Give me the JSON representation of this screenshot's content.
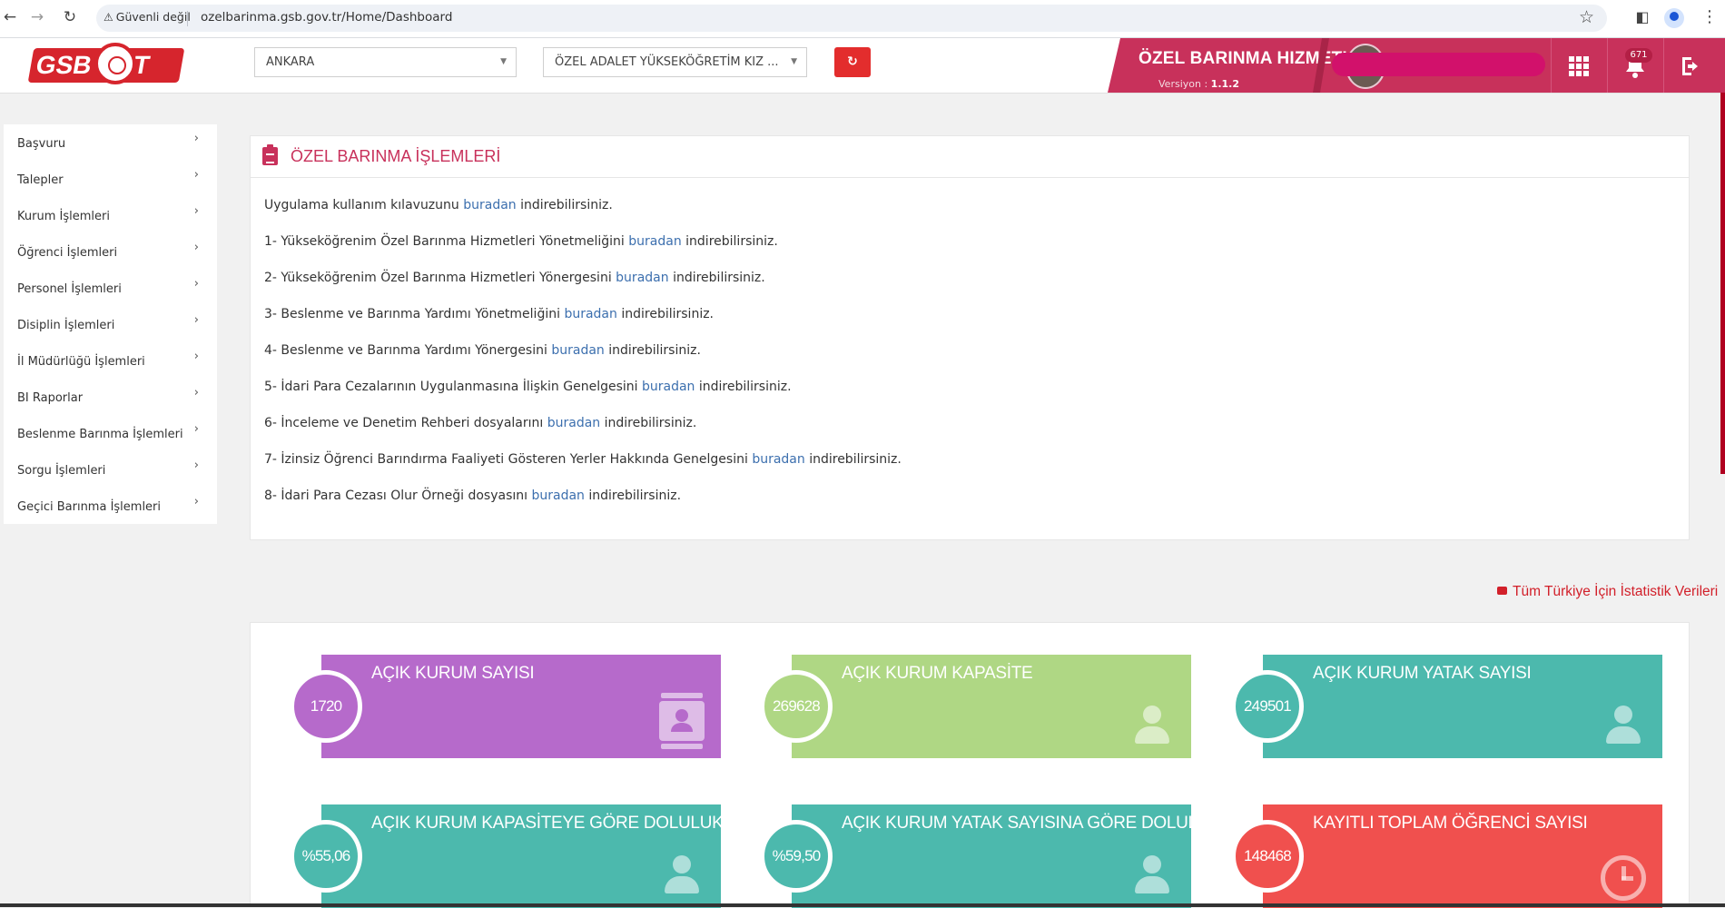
{
  "browser": {
    "security_label": "Güvenli değil",
    "url": "ozelbarinma.gsb.gov.tr/Home/Dashboard"
  },
  "header": {
    "logo_text": "GSB   NET",
    "province_select": "ANKARA",
    "institution_select": "ÖZEL ADALET YÜKSEKÖĞRETİM KIZ ...",
    "brand_title": "ÖZEL BARINMA HIZMETI",
    "version_label": "Versiyon :",
    "version_value": "1.1.2",
    "notification_count": "671",
    "colors": {
      "brand": "#c8315b",
      "logo_red": "#d6252d",
      "refresh_button": "#e32d2d"
    }
  },
  "sidebar": {
    "items": [
      {
        "label": "Başvuru"
      },
      {
        "label": "Talepler"
      },
      {
        "label": "Kurum İşlemleri"
      },
      {
        "label": "Öğrenci İşlemleri"
      },
      {
        "label": "Personel İşlemleri"
      },
      {
        "label": "Disiplin İşlemleri"
      },
      {
        "label": "İl Müdürlüğü İşlemleri"
      },
      {
        "label": "BI Raporlar"
      },
      {
        "label": "Beslenme Barınma İşlemleri"
      },
      {
        "label": "Sorgu İşlemleri"
      },
      {
        "label": "Geçici Barınma İşlemleri"
      }
    ]
  },
  "panel": {
    "title": "ÖZEL BARINMA İŞLEMLERİ",
    "link_text": "buradan",
    "lines": [
      {
        "before": "Uygulama kullanım kılavuzunu",
        "after": "indirebilirsiniz."
      },
      {
        "before": "1- Yükseköğrenim Özel Barınma Hizmetleri Yönetmeliğini",
        "after": "indirebilirsiniz."
      },
      {
        "before": "2- Yükseköğrenim Özel Barınma Hizmetleri Yönergesini",
        "after": "indirebilirsiniz."
      },
      {
        "before": "3- Beslenme ve Barınma Yardımı Yönetmeliğini",
        "after": "indirebilirsiniz."
      },
      {
        "before": "4- Beslenme ve Barınma Yardımı Yönergesini",
        "after": "indirebilirsiniz."
      },
      {
        "before": "5- İdari Para Cezalarının Uygulanmasına İlişkin Genelgesini",
        "after": "indirebilirsiniz."
      },
      {
        "before": "6- İnceleme ve Denetim Rehberi dosyalarını",
        "after": "indirebilirsiniz."
      },
      {
        "before": "7- İzinsiz Öğrenci Barındırma Faaliyeti Gösteren Yerler Hakkında Genelgesini",
        "after": "indirebilirsiniz."
      },
      {
        "before": "8- İdari Para Cezası Olur Örneği dosyasını",
        "after": "indirebilirsiniz."
      }
    ]
  },
  "stats": {
    "link_label": "Tüm Türkiye İçin İstatistik Verileri",
    "cards": [
      {
        "title": "AÇIK KURUM SAYISI",
        "value": "1720",
        "color": "#b66acb",
        "icon": "id-card-icon"
      },
      {
        "title": "AÇIK KURUM KAPASİTE",
        "value": "269628",
        "color": "#afd784",
        "icon": "person-icon"
      },
      {
        "title": "AÇIK KURUM YATAK SAYISI",
        "value": "249501",
        "color": "#4cb9ad",
        "icon": "person-icon"
      },
      {
        "title": "AÇIK KURUM KAPASİTEYE GÖRE DOLULUK ORANI",
        "value": "%55,06",
        "color": "#4cb9ad",
        "icon": "person-icon"
      },
      {
        "title": "AÇIK KURUM YATAK SAYISINA GÖRE DOLULUK ORANI",
        "value": "%59,50",
        "color": "#4cb9ad",
        "icon": "person-icon"
      },
      {
        "title": "KAYITLI TOPLAM ÖĞRENCİ SAYISI",
        "value": "148468",
        "color": "#f0504e",
        "icon": "clock-icon"
      }
    ]
  }
}
